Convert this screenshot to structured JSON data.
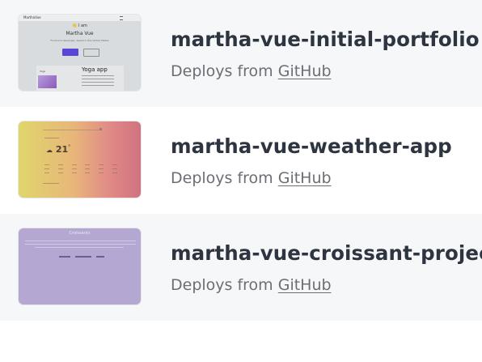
{
  "sites": [
    {
      "name": "martha-vue-initial-portfolio",
      "deploy_prefix": "Deploys from",
      "deploy_source": "GitHub",
      "thumbnail": {
        "brand": "MarthaVue",
        "greeting": "👋 I am",
        "person": "Martha Vue",
        "tagline": "Front-end developer, based in the United States",
        "card_title": "Yoga app",
        "card_thumb_label": "Yoga"
      }
    },
    {
      "name": "martha-vue-weather-app",
      "deploy_prefix": "Deploys from",
      "deploy_source": "GitHub",
      "thumbnail": {
        "temperature": "21",
        "temperature_unit": "°",
        "weather_icon": "cloud-sun-icon"
      }
    },
    {
      "name": "martha-vue-croissant-project",
      "deploy_prefix": "Deploys from",
      "deploy_source": "GitHub",
      "thumbnail": {
        "title": "Croissants"
      }
    }
  ],
  "colors": {
    "name_text": "#2e3440",
    "meta_text": "#6b6f75",
    "row_alt_bg": "#f6f7f8",
    "portfolio_button": "#5a46d6",
    "croissant_bg": "#b4a8d2"
  }
}
